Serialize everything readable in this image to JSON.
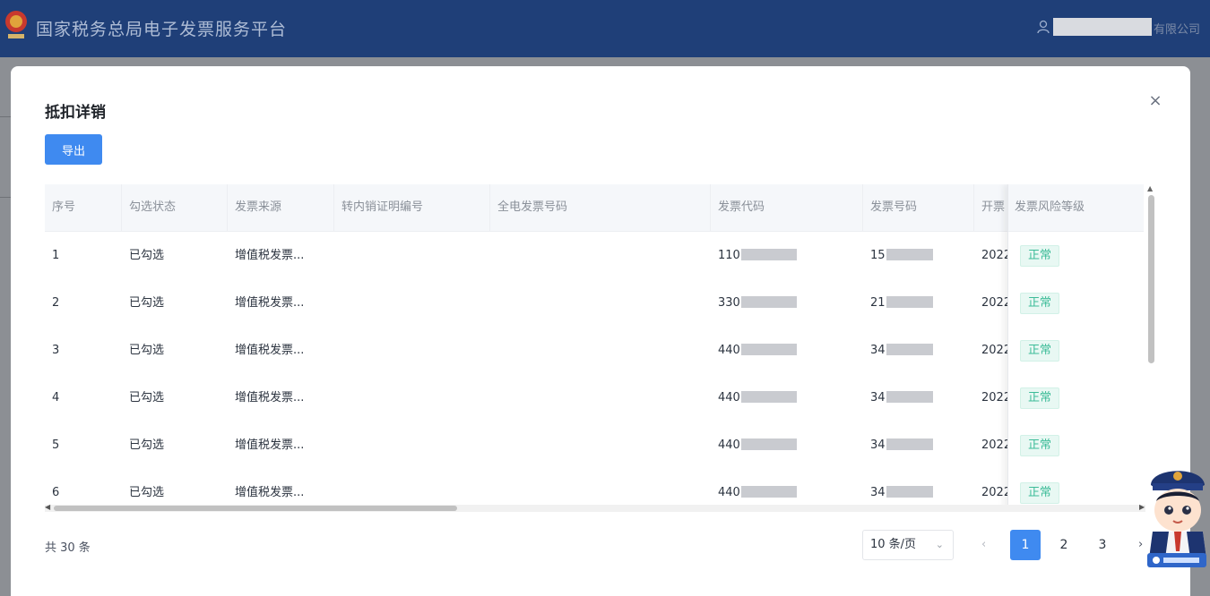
{
  "header": {
    "app_title": "国家税务总局电子发票服务平台",
    "company_suffix": "有限公司",
    "brand_color": "#1f3f78"
  },
  "modal": {
    "title": "抵扣详销",
    "close_glyph": "×",
    "export_label": "导出"
  },
  "table": {
    "columns": [
      "序号",
      "勾选状态",
      "发票来源",
      "转内销证明编号",
      "全电发票号码",
      "发票代码",
      "发票号码",
      "开票",
      "发票风险等级"
    ],
    "rows": [
      {
        "index": "1",
        "status": "已勾选",
        "source": "增值税发票...",
        "code_prefix": "110",
        "number_prefix": "15",
        "date_prefix": "2022",
        "risk": "正常"
      },
      {
        "index": "2",
        "status": "已勾选",
        "source": "增值税发票...",
        "code_prefix": "330",
        "number_prefix": "21",
        "date_prefix": "2022",
        "risk": "正常"
      },
      {
        "index": "3",
        "status": "已勾选",
        "source": "增值税发票...",
        "code_prefix": "440",
        "number_prefix": "34",
        "date_prefix": "2022",
        "risk": "正常"
      },
      {
        "index": "4",
        "status": "已勾选",
        "source": "增值税发票...",
        "code_prefix": "440",
        "number_prefix": "34",
        "date_prefix": "2022",
        "risk": "正常"
      },
      {
        "index": "5",
        "status": "已勾选",
        "source": "增值税发票...",
        "code_prefix": "440",
        "number_prefix": "34",
        "date_prefix": "2022",
        "risk": "正常"
      },
      {
        "index": "6",
        "status": "已勾选",
        "source": "增值税发票...",
        "code_prefix": "440",
        "number_prefix": "34",
        "date_prefix": "2022",
        "risk": "正常"
      }
    ],
    "risk_tag_color": "#3dbc98"
  },
  "pagination": {
    "total_label": "共 30 条",
    "page_size_label": "10 条/页",
    "prev": "‹",
    "next": "›",
    "pages": [
      "1",
      "2",
      "3"
    ],
    "current_page": "1",
    "accent": "#3f8af0"
  }
}
